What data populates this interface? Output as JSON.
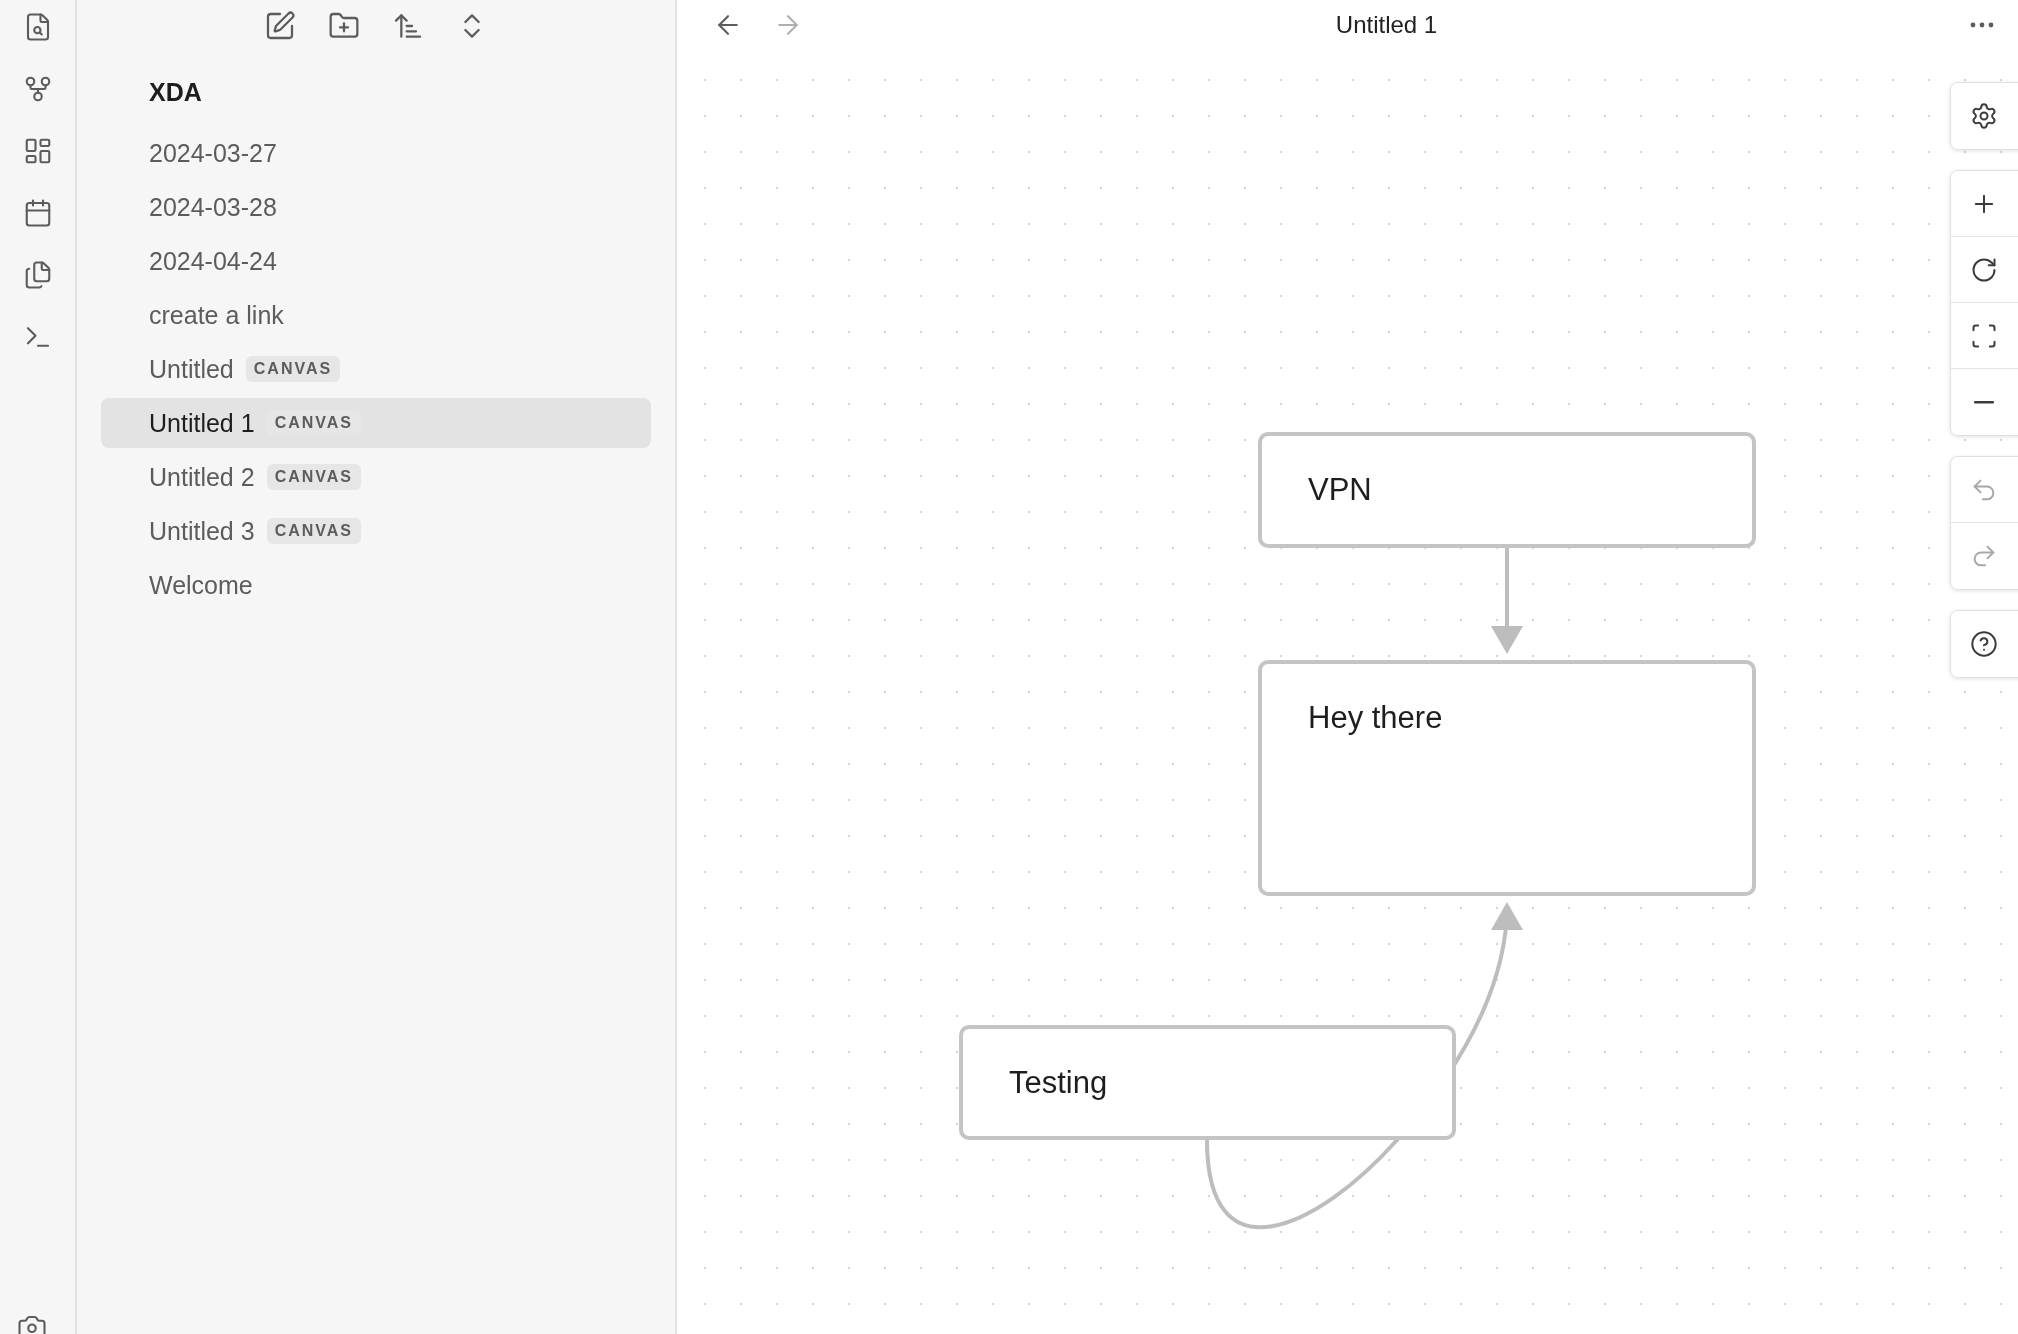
{
  "header": {
    "title": "Untitled 1",
    "back_disabled": false,
    "forward_disabled": true
  },
  "vault": {
    "name": "XDA"
  },
  "files": [
    {
      "name": "2024-03-27",
      "selected": false
    },
    {
      "name": "2024-03-28",
      "selected": false
    },
    {
      "name": "2024-04-24",
      "selected": false
    },
    {
      "name": "create a link",
      "selected": false
    },
    {
      "name": "Untitled",
      "badge": "CANVAS",
      "selected": false
    },
    {
      "name": "Untitled 1",
      "badge": "CANVAS",
      "selected": true
    },
    {
      "name": "Untitled 2",
      "badge": "CANVAS",
      "selected": false
    },
    {
      "name": "Untitled 3",
      "badge": "CANVAS",
      "selected": false
    },
    {
      "name": "Welcome",
      "selected": false
    }
  ],
  "canvas": {
    "nodes": [
      {
        "text": "VPN"
      },
      {
        "text": "Hey there"
      },
      {
        "text": "Testing"
      }
    ],
    "undo_disabled": true,
    "redo_disabled": true
  }
}
